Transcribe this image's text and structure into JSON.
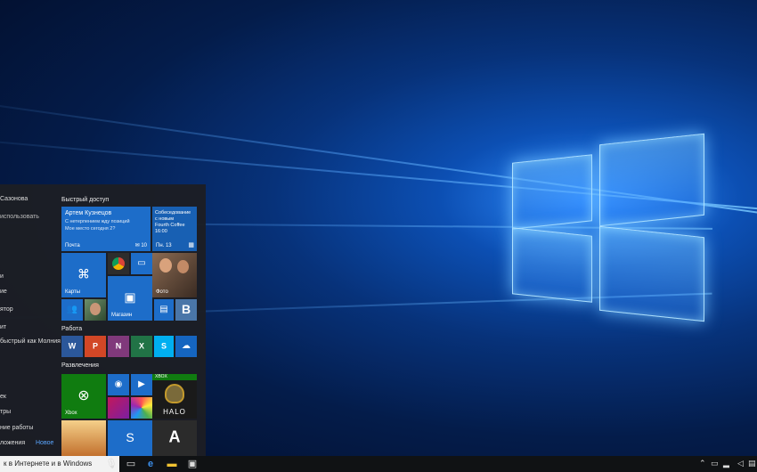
{
  "start_menu": {
    "user_name": "Сазонова",
    "most_used_label": "использовать",
    "left_items": [
      "и",
      "ие",
      "ятор",
      "ит",
      "быстрый как Молния",
      "ек",
      "тры",
      "ние работы",
      "ложения"
    ],
    "new_badge": "Новое",
    "sections": {
      "quick_access": "Быстрый доступ",
      "work": "Работа",
      "entertainment": "Развлечения"
    },
    "tiles": {
      "mail": {
        "sender": "Артем Кузнецов",
        "preview1": "С нетерпением жду позиций",
        "preview2": "Мое место сегодня 2?",
        "label": "Почта",
        "count": "10"
      },
      "calendar": {
        "line1": "Собеседование",
        "line2": "с новым",
        "line3": "Fourth Coffee",
        "line4": "16:00",
        "label": "Пн. 13"
      },
      "maps_label": "Карты",
      "photos_label": "Фото",
      "store_label": "Магазин",
      "xbox_label": "Xbox",
      "xbox_badge": "XBOX",
      "halo_text": "HALO"
    }
  },
  "taskbar": {
    "search_text": "к в Интернете и в Windows"
  },
  "colors": {
    "tile_blue": "#1d6dc9",
    "tile_dark_blue": "#1860b3",
    "word": "#2b579a",
    "powerpoint": "#d24726",
    "onenote": "#80397b",
    "excel": "#217346",
    "skype": "#00aff0",
    "onedrive": "#1565c0",
    "xbox": "#107c10"
  },
  "icons": [
    "maps-icon",
    "store-icon",
    "people-icon",
    "calculator-icon",
    "vk-icon",
    "word-icon",
    "powerpoint-icon",
    "onenote-icon",
    "excel-icon",
    "skype-icon",
    "onedrive-icon",
    "xbox-icon",
    "groove-icon",
    "movies-icon",
    "shazam-icon",
    "mic-icon",
    "task-view-icon",
    "edge-icon",
    "explorer-icon",
    "store-taskbar-icon"
  ]
}
